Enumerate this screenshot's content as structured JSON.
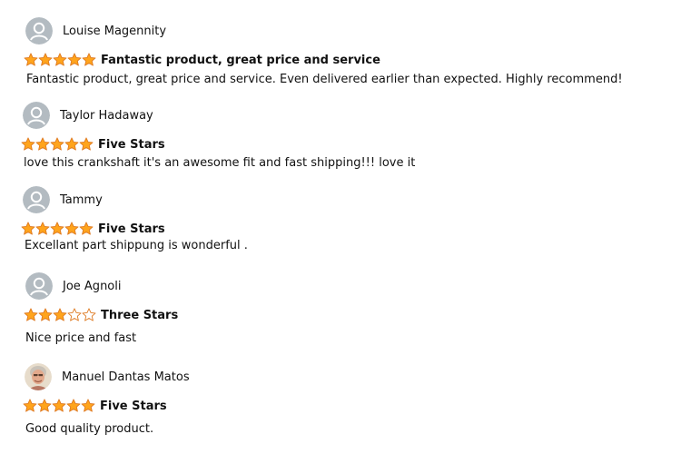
{
  "reviews": [
    {
      "author": "Louise Magennity",
      "avatar": "default-avatar",
      "rating": 5,
      "title": "Fantastic product, great price and service",
      "body": "Fantastic product, great price and service. Even delivered earlier than expected. Highly recommend!"
    },
    {
      "author": "Taylor Hadaway",
      "avatar": "default-avatar",
      "rating": 5,
      "title": "Five Stars",
      "body": "love this crankshaft it's an awesome fit and fast shipping!!! love it"
    },
    {
      "author": "Tammy",
      "avatar": "default-avatar",
      "rating": 5,
      "title": "Five Stars",
      "body": "Excellant part shippung is wonderful ."
    },
    {
      "author": "Joe Agnoli",
      "avatar": "default-avatar",
      "rating": 3,
      "title": "Three Stars",
      "body": "Nice price and fast"
    },
    {
      "author": "Manuel Dantas Matos",
      "avatar": "photo-avatar",
      "rating": 5,
      "title": "Five Stars",
      "body": "Good quality product."
    }
  ],
  "colors": {
    "star_fill": "#FFA41C",
    "star_stroke": "#DE7921",
    "star_empty_stroke": "#DE7921",
    "avatar_bg": "#B3BBC1",
    "avatar_fg": "#FFFFFF"
  }
}
